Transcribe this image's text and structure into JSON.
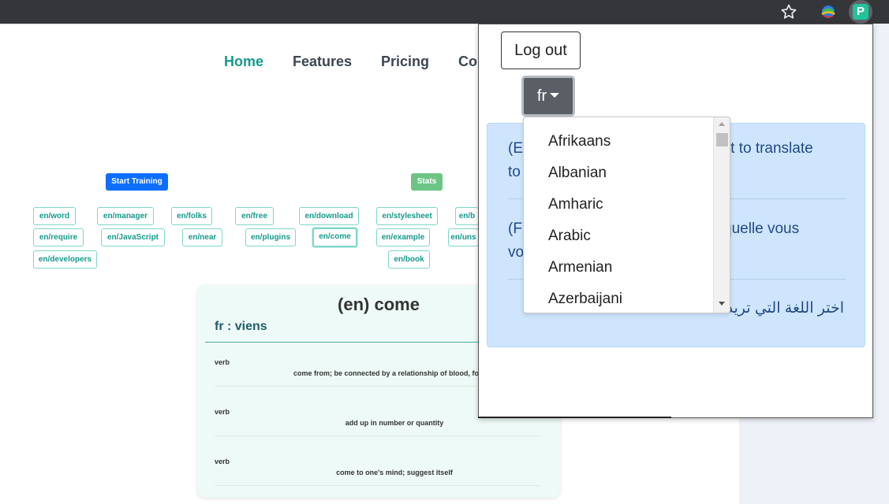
{
  "nav": {
    "items": [
      "Home",
      "Features",
      "Pricing",
      "Co"
    ]
  },
  "training": {
    "start_label": "Start Training",
    "stats_label": "Stats",
    "tags": [
      "en/word",
      "en/manager",
      "en/folks",
      "en/free",
      "en/download",
      "en/stylesheet",
      "en/b",
      "en/require",
      "en/JavaScript",
      "en/near",
      "en/plugins",
      "en/come",
      "en/example",
      "en/uns",
      "en/developers",
      "en/book"
    ]
  },
  "card": {
    "title": "(en) come",
    "translation": "fr : viens",
    "definitions": [
      {
        "pos": "verb",
        "text": "come from; be connected by a relationship of blood, for exa"
      },
      {
        "pos": "verb",
        "text": "add up in number or quantity"
      },
      {
        "pos": "verb",
        "text": "come to one's mind; suggest itself"
      }
    ]
  },
  "popup": {
    "logout_label": "Log out",
    "language_button": "fr",
    "info_lines": {
      "en_1": "(Er",
      "en_1b": "ant to translate",
      "en_2": "to",
      "fr_1": "(Fr",
      "fr_1b": "quelle vous",
      "fr_2": "vo",
      "ar": "اختر اللغة التي تريد"
    },
    "dropdown_options": [
      "Afrikaans",
      "Albanian",
      "Amharic",
      "Arabic",
      "Armenian",
      "Azerbaijani"
    ]
  },
  "colors": {
    "accent_teal": "#159a8c",
    "start_button": "#0d6efd",
    "stats_button": "#6cc585",
    "info_bg": "#cfe5fd",
    "lang_button": "#5a5f66"
  },
  "icons": [
    "star-icon",
    "globe-extension-icon",
    "p-extension-icon"
  ]
}
